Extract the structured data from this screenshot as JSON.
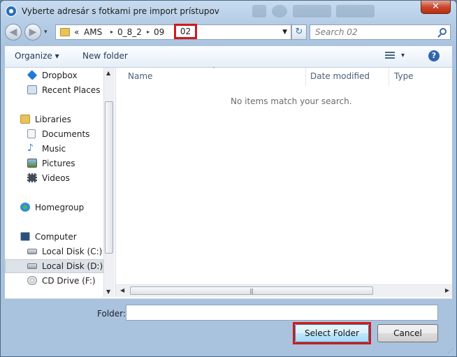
{
  "window": {
    "title": "Vyberte adresár s fotkami pre import prístupov",
    "close_label": "✕"
  },
  "nav": {
    "back_glyph": "◀",
    "forward_glyph": "▶",
    "history_glyph": "▾",
    "refresh_glyph": "↻"
  },
  "address": {
    "overflow": "«",
    "crumbs": [
      "AMS",
      "0_8_2",
      "09",
      "02"
    ],
    "separator": "▸",
    "dropdown_glyph": "▼"
  },
  "search": {
    "placeholder": "Search 02"
  },
  "toolbar": {
    "organize_label": "Organize ▾",
    "new_folder_label": "New folder",
    "view_dropdown": "▾",
    "help_label": "?"
  },
  "navigation_pane": {
    "items": [
      {
        "label": "Dropbox",
        "icon": "dropbox-icon",
        "color": "#1f7ad8"
      },
      {
        "label": "Recent Places",
        "icon": "recent-places-icon",
        "color": "#6d8db0"
      },
      {
        "label": "Libraries",
        "icon": "libraries-icon",
        "color": "#e7c35a"
      },
      {
        "label": "Documents",
        "icon": "documents-icon",
        "color": "#d9e2ec"
      },
      {
        "label": "Music",
        "icon": "music-icon",
        "color": "#3a78c8"
      },
      {
        "label": "Pictures",
        "icon": "pictures-icon",
        "color": "#6aa0d8"
      },
      {
        "label": "Videos",
        "icon": "videos-icon",
        "color": "#404a56"
      },
      {
        "label": "Homegroup",
        "icon": "homegroup-icon",
        "color": "#2e8fd6"
      },
      {
        "label": "Computer",
        "icon": "computer-icon",
        "color": "#4a6fa0"
      },
      {
        "label": "Local Disk (C:)",
        "icon": "local-disk-c-icon",
        "color": "#9aa3ad"
      },
      {
        "label": "Local Disk (D:)",
        "icon": "local-disk-d-icon",
        "color": "#9aa3ad",
        "selected": true
      },
      {
        "label": "CD Drive (F:)",
        "icon": "cd-drive-icon",
        "color": "#b9c0c8"
      }
    ],
    "scroll_up": "▲",
    "scroll_down": "▼"
  },
  "file_list": {
    "columns": [
      "Name",
      "Date modified",
      "Type"
    ],
    "sort_indicator": "˄",
    "empty_message": "No items match your search.",
    "scroll_left": "◀",
    "scroll_right": "▶",
    "grip": "|||"
  },
  "footer": {
    "folder_label": "Folder:",
    "folder_value": "",
    "select_button": "Select Folder",
    "cancel_button": "Cancel"
  }
}
